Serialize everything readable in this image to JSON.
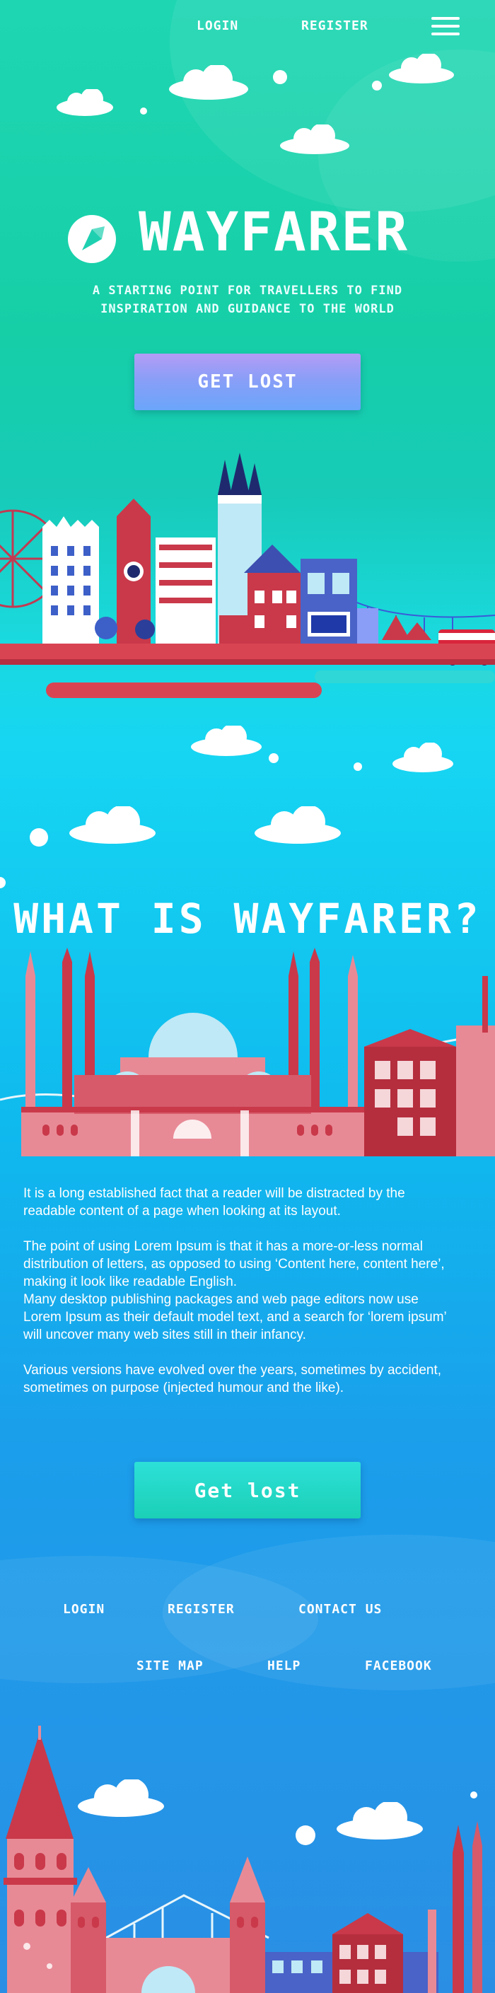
{
  "nav": {
    "login": "LOGIN",
    "register": "REGISTER",
    "menu_icon": "hamburger-menu-icon"
  },
  "hero": {
    "brand": "WAYFARER",
    "logo_icon": "compass-logo-icon",
    "tagline_line1": "A STARTING POINT FOR TRAVELLERS TO FIND",
    "tagline_line2": "INSPIRATION AND GUIDANCE TO THE WORLD",
    "cta": "GET LOST"
  },
  "about": {
    "title": "WHAT IS WAYFARER?",
    "paragraphs": [
      "It is a long established fact that a reader will be distracted by the readable content of a page when looking at its layout.",
      "The point of using Lorem Ipsum is that it has a more-or-less normal distribution of letters, as opposed to using ‘Content here, content here’, making it look like readable English.",
      "Many desktop publishing packages and web page editors now use Lorem Ipsum as their default model text, and a search for ‘lorem ipsum’ will uncover many web sites still in their infancy.",
      "Various versions have evolved over the years, sometimes by accident, sometimes on purpose (injected humour and the like)."
    ],
    "cta": "Get lost"
  },
  "footer": {
    "links_row1": [
      "LOGIN",
      "REGISTER",
      "CONTACT US"
    ],
    "links_row2": [
      "SITE MAP",
      "HELP",
      "FACEBOOK"
    ]
  },
  "colors": {
    "hero_top": "#1fd6b3",
    "mid": "#16d6f2",
    "bottom": "#2a8fe4",
    "building_red": "#c9394a",
    "building_pink": "#e88a96",
    "hero_button": "#8a9ef7",
    "cta_button": "#1bd0b6"
  }
}
